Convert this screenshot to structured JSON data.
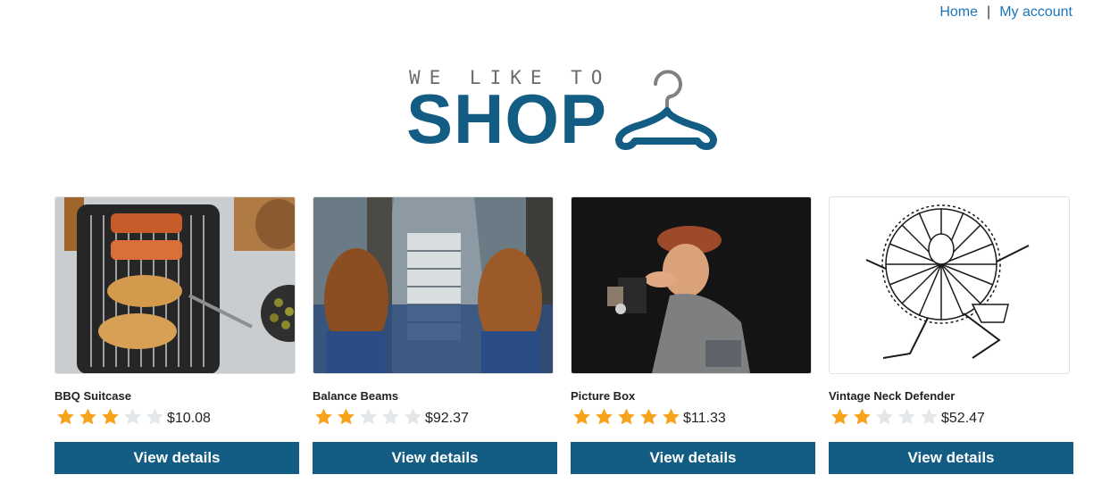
{
  "nav": {
    "home": "Home",
    "separator": "|",
    "account": "My account"
  },
  "logo": {
    "tagline": "WE LIKE TO",
    "word": "SHOP"
  },
  "products": [
    {
      "name": "BBQ Suitcase",
      "rating": 3,
      "price": "$10.08",
      "button": "View details"
    },
    {
      "name": "Balance Beams",
      "rating": 2,
      "price": "$92.37",
      "button": "View details"
    },
    {
      "name": "Picture Box",
      "rating": 5,
      "price": "$11.33",
      "button": "View details"
    },
    {
      "name": "Vintage Neck Defender",
      "rating": 2,
      "price": "$52.47",
      "button": "View details"
    }
  ],
  "colors": {
    "brand": "#135d84",
    "link": "#1b75bb",
    "star_on": "#f7a21b",
    "star_off": "#e3e7ea"
  }
}
